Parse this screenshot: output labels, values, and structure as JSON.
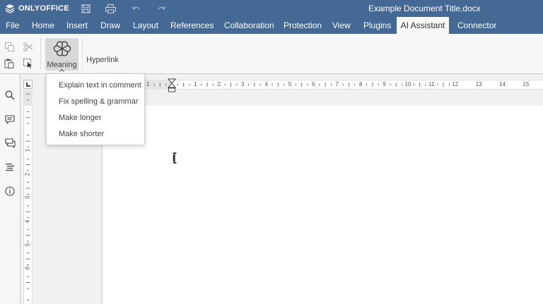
{
  "app": {
    "brand": "ONLYOFFICE",
    "doc_title": "Example Document Title.docx"
  },
  "titlebar_icons": [
    "save-icon",
    "print-icon",
    "undo-icon",
    "redo-icon"
  ],
  "tabs": [
    {
      "label": "File"
    },
    {
      "label": "Home"
    },
    {
      "label": "Insert"
    },
    {
      "label": "Draw"
    },
    {
      "label": "Layout"
    },
    {
      "label": "References"
    },
    {
      "label": "Collaboration"
    },
    {
      "label": "Protection"
    },
    {
      "label": "View"
    },
    {
      "label": "Plugins"
    },
    {
      "label": "AI Assistant",
      "active": true
    },
    {
      "label": "Connector"
    }
  ],
  "toolbar": {
    "meaning_label": "Meaning",
    "hyperlink_label": "Hyperlink"
  },
  "dropdown": {
    "items": [
      {
        "label": "Explain text in comment"
      },
      {
        "label": "Fix spelling & grammar"
      },
      {
        "label": "Make longer"
      },
      {
        "label": "Make shorter"
      }
    ]
  },
  "ruler": {
    "h_numbers": [
      "1",
      "1",
      "2",
      "3",
      "4",
      "5",
      "6",
      "7",
      "8",
      "9",
      "10",
      "11",
      "12",
      "13",
      "14",
      "15"
    ],
    "v_numbers": [
      "1",
      "2",
      "3",
      "4",
      "5",
      "6"
    ]
  },
  "colors": {
    "header": "#446995",
    "toolbar": "#f7f7f7",
    "active_button": "#d8d8d8"
  }
}
